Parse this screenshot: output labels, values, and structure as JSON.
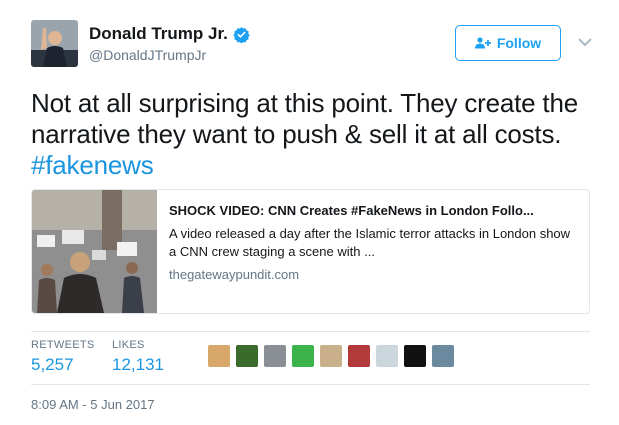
{
  "author": {
    "display_name": "Donald Trump Jr.",
    "handle": "@DonaldJTrumpJr",
    "verified": true
  },
  "follow_button": {
    "label": "Follow",
    "icon": "add-user-icon"
  },
  "tweet": {
    "text_part1": "Not at all surprising at this point. They create the narrative they want to push & sell it at all costs. ",
    "hashtag": "#fakenews"
  },
  "card": {
    "title": "SHOCK VIDEO: CNN Creates #FakeNews in London Follo...",
    "description": "A video released a day after the Islamic terror attacks in London show a CNN crew staging a scene with ...",
    "domain": "thegatewaypundit.com"
  },
  "stats": {
    "retweets_label": "RETWEETS",
    "retweets_value": "5,257",
    "likes_label": "LIKES",
    "likes_value": "12,131"
  },
  "liker_avatars": [
    {
      "name": "liker-avatar-1",
      "color": "#d8a86a"
    },
    {
      "name": "liker-avatar-2",
      "color": "#3b6b2a"
    },
    {
      "name": "liker-avatar-3",
      "color": "#8a8f96"
    },
    {
      "name": "liker-avatar-4",
      "color": "#3bb34a"
    },
    {
      "name": "liker-avatar-5",
      "color": "#c9b08a"
    },
    {
      "name": "liker-avatar-6",
      "color": "#b23a3a"
    },
    {
      "name": "liker-avatar-7",
      "color": "#ccd6dd"
    },
    {
      "name": "liker-avatar-8",
      "color": "#111111"
    },
    {
      "name": "liker-avatar-9",
      "color": "#6b8aa0"
    }
  ],
  "timestamp": "8:09 AM - 5 Jun 2017",
  "colors": {
    "accent": "#1da1f2",
    "link": "#1b95e0",
    "muted": "#657786",
    "border": "#e1e8ed"
  }
}
